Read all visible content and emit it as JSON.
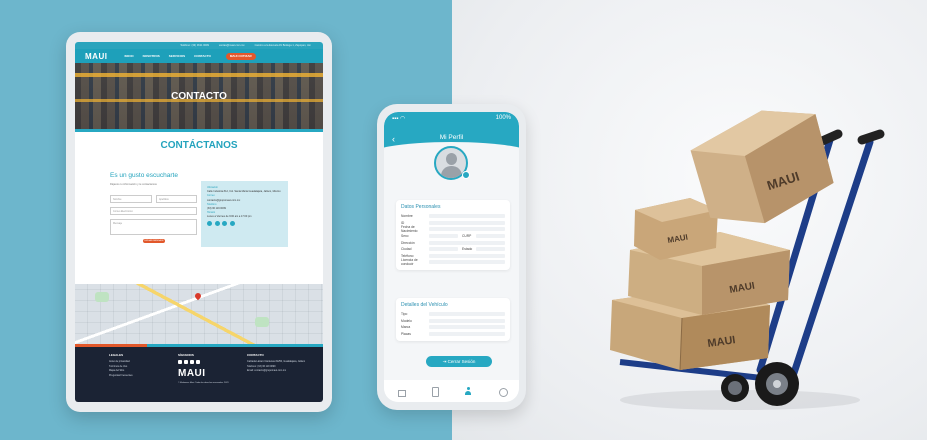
{
  "tablet": {
    "topbar": {
      "phone": "Teléfono: (33) 3611 0099",
      "email": "ventas@maui.com.mx",
      "address": "Camino a la Escuela #1 Bodega 1, Zapopan, Jal."
    },
    "nav": {
      "logo": "MAUI",
      "links": [
        "INICIO",
        "NOSOTROS",
        "SERVICIOS",
        "CONTACTO"
      ],
      "cta": "MAUI COTIZAR"
    },
    "hero_title": "CONTACTO",
    "section_title": "CONTÁCTANOS",
    "form": {
      "heading": "Es un gusto escucharte",
      "subtitle": "Déjanos tu información y te contactamos",
      "placeholders": {
        "name": "Nombre",
        "last_name": "Apellidos",
        "email": "Correo Electrónico",
        "message": "Mensaje"
      },
      "send_label": "ENVIAR MENSAJE"
    },
    "info": {
      "address_label": "Ubicación",
      "address": "Calle Industria #12, Col. Santa Maria Guadalajara, Jalisco, México",
      "email_label": "Correo",
      "email": "contacto@grupomaui.com.mx",
      "phone_label": "Teléfono",
      "phone": "(33) 36 119 0099",
      "hours_label": "Horario",
      "hours": "Lunes a Viernes de 9:00 am a 17:00 pm"
    },
    "footer": {
      "col1_title": "LEGALES",
      "col1_items": [
        "Aviso de privacidad",
        "Términos de Uso",
        "Mapa del Sitio",
        "Preguntas Frecuentes"
      ],
      "col2_title": "SÍGUENOS",
      "col2_logo": "MAUI",
      "copyright": "© Mudanzas Maui. Todos los derechos reservados. 2023",
      "col3_title": "CONTACTO",
      "col3_items": [
        "Calzada Lázaro Cárdenas #1250, Guadalajara, Jalisco",
        "Teléfono: (33) 36 119 0099",
        "Email: contacto@grupomaui.com.mx"
      ]
    }
  },
  "phone": {
    "status": {
      "battery": "100%"
    },
    "title": "Mi Perfil",
    "personal": {
      "title": "Datos Personales",
      "fields": [
        "Nombre",
        "ID",
        "Fecha de Nacimiento",
        "Sexo",
        "Dirección",
        "Ciudad",
        "Teléfono",
        "Licencia de conducir"
      ],
      "curp_label": "CURP",
      "state_label": "Estado"
    },
    "vehicle": {
      "title": "Detalles del Vehículo",
      "fields": [
        "Tipo",
        "Modelo",
        "Marca",
        "Placas"
      ]
    },
    "logout_label": "Cerrar Sesión"
  },
  "photo": {
    "box_stamp": "MAUI"
  },
  "colors": {
    "brand_teal": "#27a8c2",
    "accent_orange": "#e2582b",
    "footer_navy": "#1b2334",
    "background_left": "#6db6cc"
  }
}
